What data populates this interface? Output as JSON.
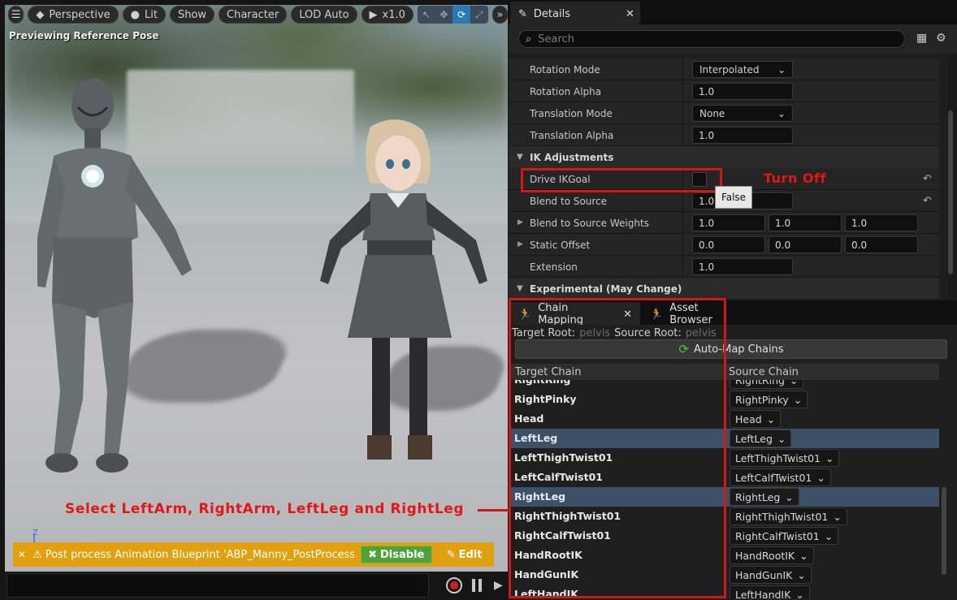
{
  "viewport": {
    "toolbar": {
      "perspective": "Perspective",
      "lit": "Lit",
      "show": "Show",
      "character": "Character",
      "lod": "LOD Auto",
      "speed": "x1.0"
    },
    "preview_label": "Previewing Reference Pose",
    "notification": {
      "message": "Post process Animation Blueprint 'ABP_Manny_PostProcess' is run",
      "disable": "Disable",
      "edit": "Edit"
    },
    "axis_label": "Z"
  },
  "annotations": {
    "select_note": "Select LeftArm, RightArm, LeftLeg and RightLeg",
    "turn_off": "Turn Off"
  },
  "details": {
    "tab": "Details",
    "search_placeholder": "Search",
    "rows": {
      "rotation_mode": {
        "label": "Rotation Mode",
        "value": "Interpolated"
      },
      "rotation_alpha": {
        "label": "Rotation Alpha",
        "value": "1.0"
      },
      "translation_mode": {
        "label": "Translation Mode",
        "value": "None"
      },
      "translation_alpha": {
        "label": "Translation Alpha",
        "value": "1.0"
      },
      "ik_adjustments": "IK Adjustments",
      "drive_ikgoal": {
        "label": "Drive IKGoal",
        "tooltip": "False"
      },
      "blend_to_source": {
        "label": "Blend to Source",
        "value": "1.0"
      },
      "blend_to_source_weights": {
        "label": "Blend to Source Weights",
        "x": "1.0",
        "y": "1.0",
        "z": "1.0"
      },
      "static_offset": {
        "label": "Static Offset",
        "x": "0.0",
        "y": "0.0",
        "z": "0.0"
      },
      "extension": {
        "label": "Extension",
        "value": "1.0"
      },
      "experimental": "Experimental (May Change)"
    }
  },
  "chain_mapping": {
    "tab": "Chain Mapping",
    "asset_browser_tab": "Asset Browser",
    "target_root_label": "Target Root:",
    "target_root_value": "pelvis",
    "source_root_label": "Source Root:",
    "source_root_value": "pelvis",
    "auto_map": "Auto-Map Chains",
    "col_target": "Target Chain",
    "col_source": "Source Chain",
    "rows": [
      {
        "target": "RightRing",
        "source": "RightRing"
      },
      {
        "target": "RightPinky",
        "source": "RightPinky"
      },
      {
        "target": "Head",
        "source": "Head"
      },
      {
        "target": "LeftLeg",
        "source": "LeftLeg"
      },
      {
        "target": "LeftThighTwist01",
        "source": "LeftThighTwist01"
      },
      {
        "target": "LeftCalfTwist01",
        "source": "LeftCalfTwist01"
      },
      {
        "target": "RightLeg",
        "source": "RightLeg"
      },
      {
        "target": "RightThighTwist01",
        "source": "RightThighTwist01"
      },
      {
        "target": "RightCalfTwist01",
        "source": "RightCalfTwist01"
      },
      {
        "target": "HandRootIK",
        "source": "HandRootIK"
      },
      {
        "target": "HandGunIK",
        "source": "HandGunIK"
      },
      {
        "target": "LeftHandIK",
        "source": "LeftHandIK"
      }
    ]
  },
  "colors": {
    "accent_red": "#d01818",
    "selection": "#3c5068",
    "warning": "#e0a010",
    "disable_green": "#52a03a"
  }
}
